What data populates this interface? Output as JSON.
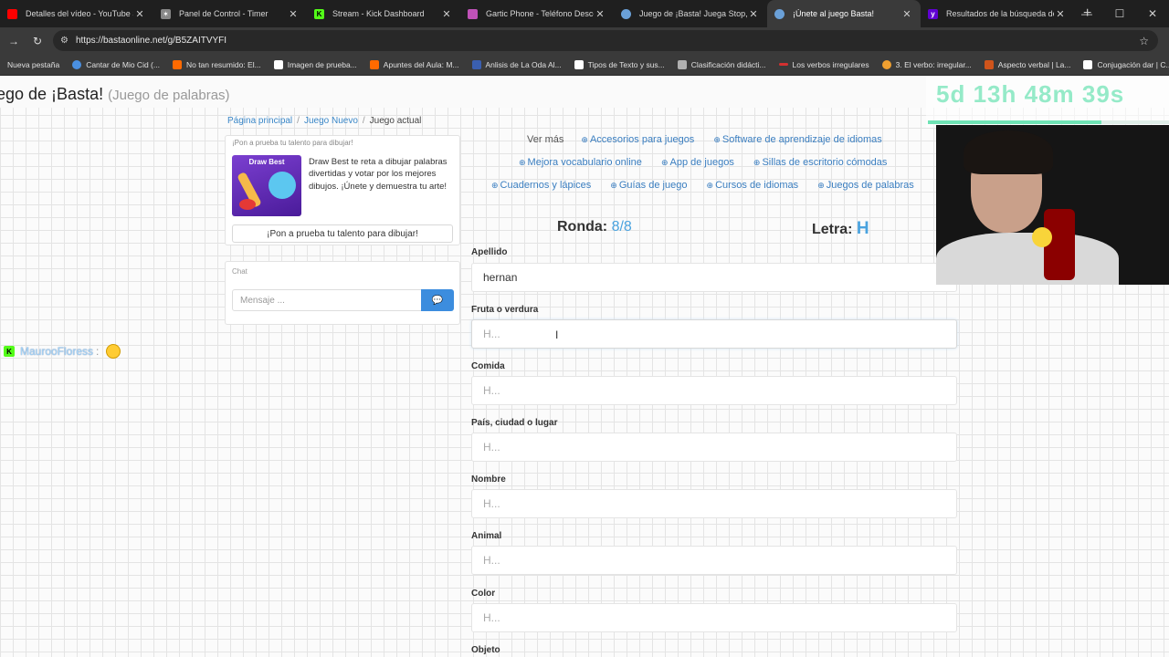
{
  "browser": {
    "tabs": [
      {
        "title": "Detalles del vídeo - YouTube Studio",
        "color": "#ff0000",
        "icon": "youtube-icon"
      },
      {
        "title": "Panel de Control - Timer",
        "color": "#888888",
        "icon": "timer-icon"
      },
      {
        "title": "Stream - Kick Dashboard",
        "color": "#53fc18",
        "icon": "kick-icon"
      },
      {
        "title": "Gartic Phone - Teléfono Descompuesto",
        "color": "#c052b8",
        "icon": "gartic-icon"
      },
      {
        "title": "Juego de ¡Basta! Juega Stop, Tutti Frutti",
        "color": "#6aa0d8",
        "icon": "globe-icon"
      },
      {
        "title": "¡Únete al juego Basta!",
        "color": "#6aa0d8",
        "icon": "globe-icon"
      },
      {
        "title": "Resultados de la búsqueda de Yahoo",
        "color": "#6001d2",
        "icon": "yahoo-icon"
      }
    ],
    "url": "https://bastaonline.net/g/B5ZAITVYFI",
    "bookmarks": [
      {
        "label": "Nueva pestaña",
        "color": "#3a3a3a"
      },
      {
        "label": "Cantar de Mio Cid (...",
        "color": "#4a90e2"
      },
      {
        "label": "No tan resumido: El...",
        "color": "#ff6a00"
      },
      {
        "label": "Imagen de prueba...",
        "color": "#ffffff"
      },
      {
        "label": "Apuntes del Aula: M...",
        "color": "#ff6a00"
      },
      {
        "label": "Anlisis de La Oda Al...",
        "color": "#3a5fb0"
      },
      {
        "label": "Tipos de Texto y sus...",
        "color": "#ffffff"
      },
      {
        "label": "Clasificación didácti...",
        "color": "#b0b0b0"
      },
      {
        "label": "Los verbos irregulares",
        "color": "#d43030"
      },
      {
        "label": "3. El verbo: irregular...",
        "color": "#f0a030"
      },
      {
        "label": "Aspecto verbal | La...",
        "color": "#d0541b"
      },
      {
        "label": "Conjugación dar | C...",
        "color": "#ffffff"
      }
    ]
  },
  "header": {
    "title": "ego de ¡Basta!",
    "subtitle": "(Juego de palabras)"
  },
  "breadcrumb": {
    "home": "Página principal",
    "new": "Juego Nuevo",
    "current": "Juego actual"
  },
  "promo": {
    "heading": "¡Pon a prueba tu talento para dibujar!",
    "image_label": "Draw Best",
    "text": "Draw Best te reta a dibujar palabras divertidas y votar por los mejores dibujos. ¡Únete y demuestra tu arte!",
    "button": "¡Pon a prueba tu talento para dibujar!"
  },
  "chat": {
    "title": "Chat",
    "placeholder": "Mensaje ..."
  },
  "stream_chat": {
    "user": "MaurooFloress",
    "colon": ":"
  },
  "links": {
    "ver_mas": "Ver más",
    "row1": [
      "Accesorios para juegos",
      "Software de aprendizaje de idiomas"
    ],
    "row2": [
      "Mejora vocabulario online",
      "App de juegos",
      "Sillas de escritorio cómodas"
    ],
    "row3": [
      "Cuadernos y lápices",
      "Guías de juego",
      "Cursos de idiomas",
      "Juegos de palabras"
    ]
  },
  "game": {
    "ronda_label": "Ronda:",
    "ronda_value": "8/8",
    "letra_label": "Letra:",
    "letra_value": "H"
  },
  "fields": [
    {
      "label": "Apellido",
      "value": "hernan",
      "placeholder": ""
    },
    {
      "label": "Fruta o verdura",
      "value": "",
      "placeholder": "H..."
    },
    {
      "label": "Comida",
      "value": "",
      "placeholder": "H..."
    },
    {
      "label": "País, ciudad o lugar",
      "value": "",
      "placeholder": "H..."
    },
    {
      "label": "Nombre",
      "value": "",
      "placeholder": "H..."
    },
    {
      "label": "Animal",
      "value": "",
      "placeholder": "H..."
    },
    {
      "label": "Color",
      "value": "",
      "placeholder": "H..."
    },
    {
      "label": "Objeto",
      "value": "",
      "placeholder": ""
    }
  ],
  "overlay": {
    "timer": "5d 13h 48m 39s"
  }
}
